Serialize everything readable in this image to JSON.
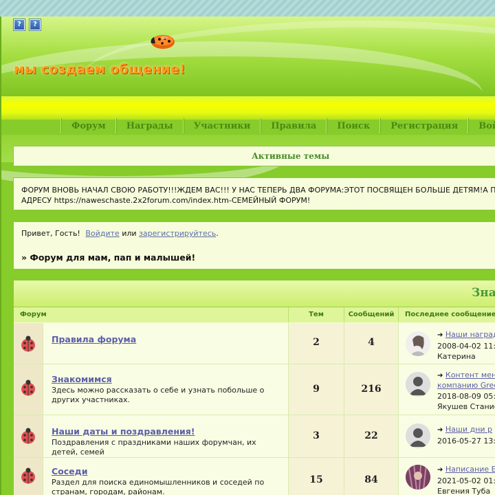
{
  "header": {
    "help_buttons": [
      "?",
      "?"
    ],
    "slogan": "мы создаем общение!"
  },
  "nav": {
    "items": [
      "Форум",
      "Награды",
      "Участники",
      "Правила",
      "Поиск",
      "Регистрация",
      "Войт"
    ]
  },
  "active_topics": {
    "label": "Активные темы"
  },
  "announcement": {
    "line1": "ФОРУМ ВНОВЬ НАЧАЛ СВОЮ РАБОТУ!!!ЖДЕМ ВАС!!! У НАС ТЕПЕРЬ ДВА ФОРУМА:ЭТОТ ПОСВЯЩЕН БОЛЬШЕ ДЕТЯМ!А ПО",
    "line2": "АДРЕСУ https://naweschaste.2x2forum.com/index.htm-СЕМЕЙНЫЙ ФОРУМ!"
  },
  "greeting": {
    "hello": "Привет, Гость!",
    "login": "Войдите",
    "or": "или",
    "register": "зарегистрируйтесь",
    "period": ".",
    "forum_title": "» Форум для мам, пап и малышей!"
  },
  "table": {
    "category": "Знак",
    "columns": {
      "forum": "Форум",
      "topics": "Тем",
      "posts": "Сообщений",
      "last": "Последнее сообщение"
    },
    "rows": [
      {
        "name": "Правила форума",
        "desc": "",
        "topics": "2",
        "posts": "4",
        "last_title": "Наши наград",
        "last_title2": "",
        "last_date": "2008-04-02 11:",
        "last_user": "Катерина",
        "avatar": "photo-woman"
      },
      {
        "name": "Знакомимся",
        "desc": "Здесь можно рассказать о себе и узнать побольше о других участниках.",
        "topics": "9",
        "posts": "216",
        "last_title": "Контент мен",
        "last_title2": "компанию Gree",
        "last_date": "2018-08-09 05:",
        "last_user": "Якушев Станис",
        "avatar": "default"
      },
      {
        "name": "Наши даты и поздравления!",
        "desc": "Поздравления с праздниками наших форумчан, их детей, семей",
        "topics": "3",
        "posts": "22",
        "last_title": "Наши дни р",
        "last_title2": "",
        "last_date": "2016-05-27 13:",
        "last_user": "",
        "avatar": "default"
      },
      {
        "name": "Соседи",
        "desc": "Раздел для поиска единомышленников и соседей по странам, городам, районам.",
        "topics": "15",
        "posts": "84",
        "last_title": "Написание Е",
        "last_title2": "",
        "last_date": "2021-05-02 01:",
        "last_user": "Евгения Туба",
        "avatar": "photo-girl"
      }
    ]
  },
  "colors": {
    "accent_green": "#86cc2a",
    "link_blue": "#5b5fa8",
    "panel_bg": "#f7fddc"
  }
}
